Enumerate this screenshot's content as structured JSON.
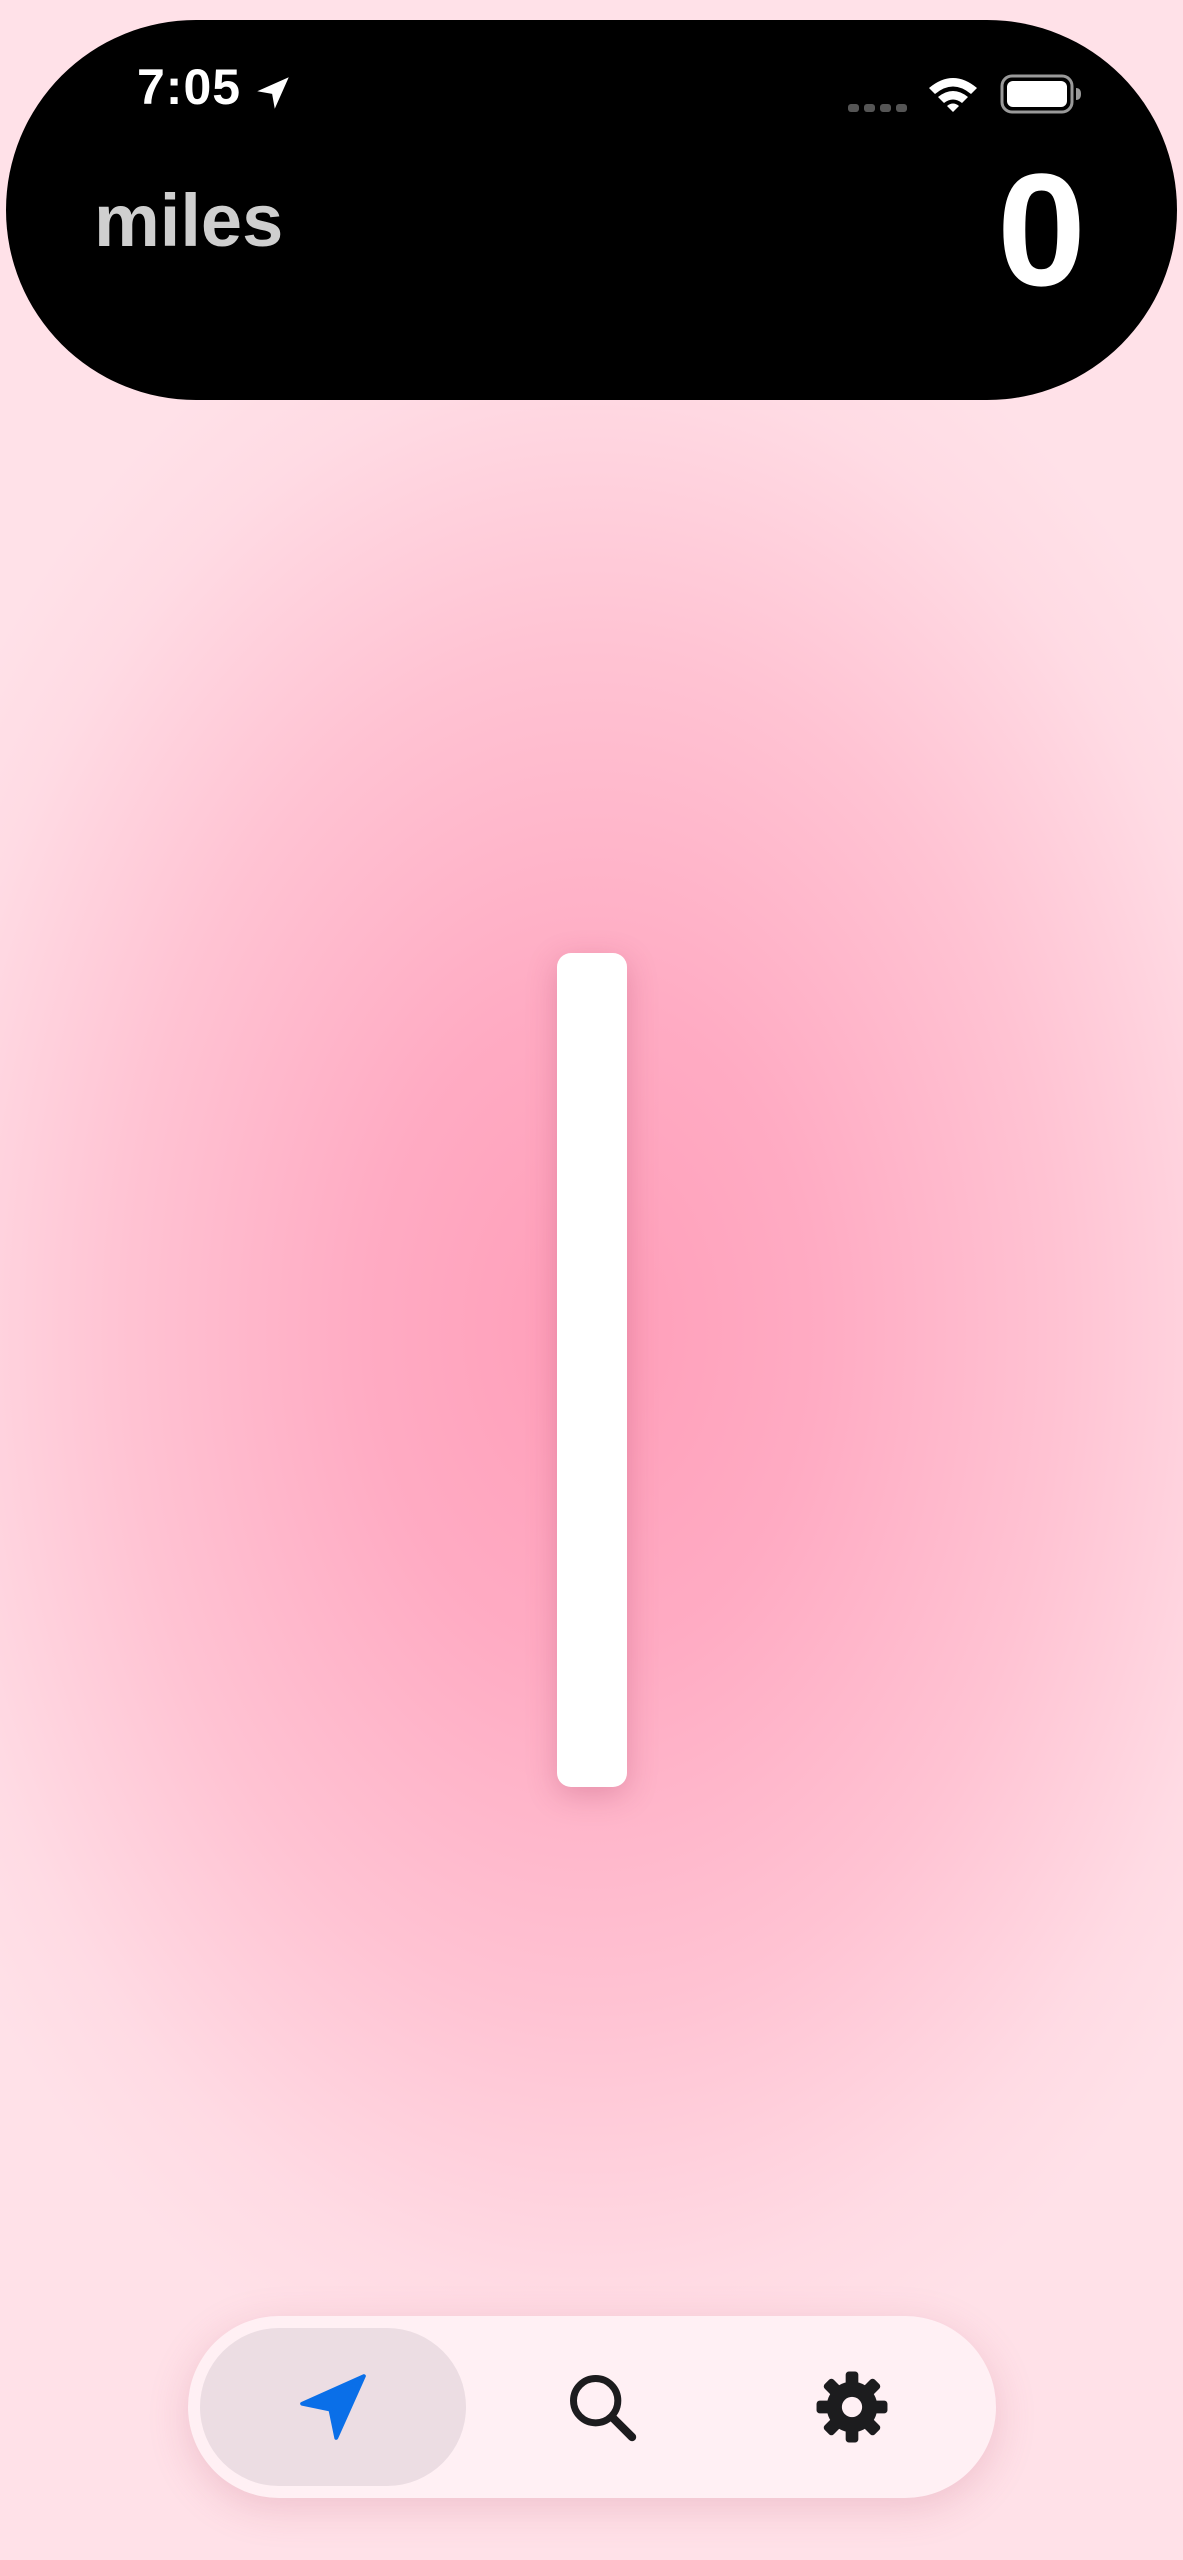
{
  "status_bar": {
    "time": "7:05",
    "location_icon": "location-arrow-icon",
    "signal_icon": "cell-signal-icon",
    "wifi_icon": "wifi-icon",
    "battery_icon": "battery-icon",
    "battery_level_fraction": 1.0
  },
  "header": {
    "unit_label": "miles",
    "distance_value": "0"
  },
  "tab_bar": {
    "tabs": [
      {
        "id": "navigate",
        "icon": "navigation-arrow-icon",
        "selected": true
      },
      {
        "id": "search",
        "icon": "magnifying-glass-icon",
        "selected": false
      },
      {
        "id": "settings",
        "icon": "gear-icon",
        "selected": false
      }
    ]
  },
  "colors": {
    "accent": "#0a6fe8",
    "banner_background": "#000000",
    "unit_label": "#cfcfcf",
    "background_center": "#ff9eb9",
    "background_edge": "#ffe1e8",
    "tab_selected_background": "#ecdde3",
    "icon_dark": "#1c1c1e"
  }
}
